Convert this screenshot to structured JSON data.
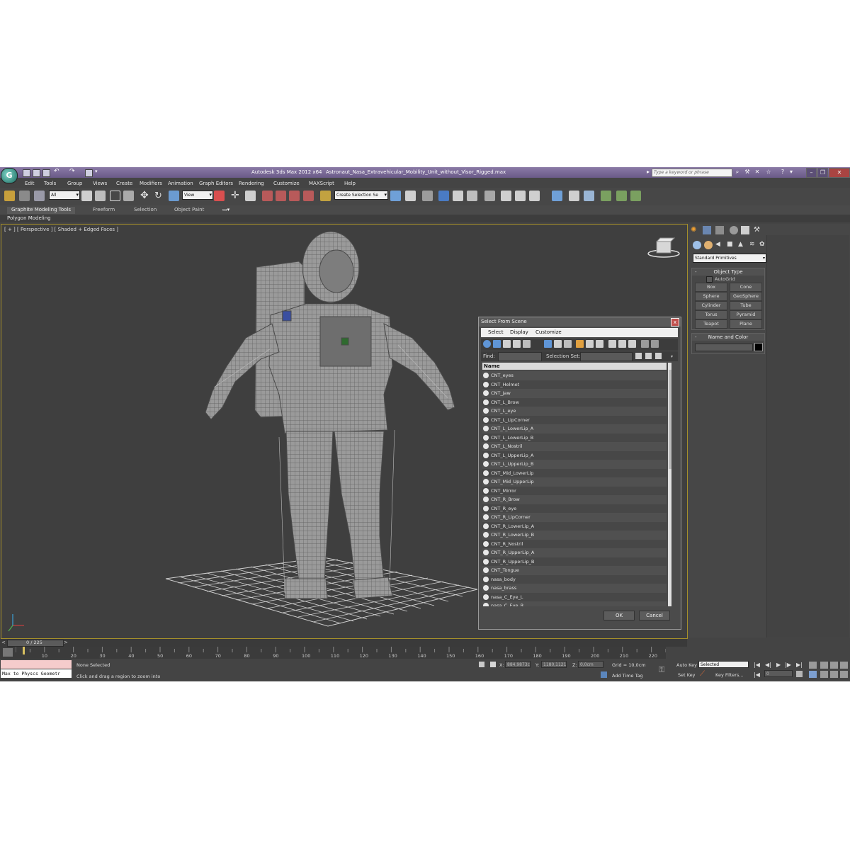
{
  "titlebar": {
    "app_name": "Autodesk 3ds Max  2012 x64",
    "file_name": "Astronaut_Nasa_Extravehicular_Mobility_Unit_without_Visor_Rigged.max",
    "search_placeholder": "Type a keyword or phrase"
  },
  "menu": [
    "Edit",
    "Tools",
    "Group",
    "Views",
    "Create",
    "Modifiers",
    "Animation",
    "Graph Editors",
    "Rendering",
    "Customize",
    "MAXScript",
    "Help"
  ],
  "toolbar": {
    "filter_value": "All",
    "refcoord_value": "View",
    "selection_set_value": "Create Selection Se"
  },
  "ribbon": {
    "tabs": [
      "Graphite Modeling Tools",
      "Freeform",
      "Selection",
      "Object Paint"
    ],
    "subpanel": "Polygon Modeling"
  },
  "viewport": {
    "label": "[ + ] [ Perspective ] [ Shaded + Edged Faces ]"
  },
  "command_panel": {
    "dropdown": "Standard Primitives",
    "object_type_title": "Object Type",
    "autogrid_label": "AutoGrid",
    "buttons": [
      "Box",
      "Cone",
      "Sphere",
      "GeoSphere",
      "Cylinder",
      "Tube",
      "Torus",
      "Pyramid",
      "Teapot",
      "Plane"
    ],
    "name_color_title": "Name and Color",
    "object_color": "#000000"
  },
  "dialog": {
    "title": "Select From Scene",
    "close_glyph": "x",
    "menus": [
      "Select",
      "Display",
      "Customize"
    ],
    "find_label": "Find:",
    "selection_set_label": "Selection Set:",
    "column_header": "Name",
    "items": [
      "CNT_eyes",
      "CNT_Helmet",
      "CNT_Jaw",
      "CNT_L_Brow",
      "CNT_L_eye",
      "CNT_L_LipCorner",
      "CNT_L_LowerLip_A",
      "CNT_L_LowerLip_B",
      "CNT_L_Nostril",
      "CNT_L_UpperLip_A",
      "CNT_L_UpperLip_B",
      "CNT_Mid_LowerLip",
      "CNT_Mid_UpperLip",
      "CNT_Mirror",
      "CNT_R_Brow",
      "CNT_R_eye",
      "CNT_R_LipCorner",
      "CNT_R_LowerLip_A",
      "CNT_R_LowerLip_B",
      "CNT_R_Nostril",
      "CNT_R_UpperLip_A",
      "CNT_R_UpperLip_B",
      "CNT_Tongue",
      "nasa_body",
      "nasa_brass",
      "nasa_C_Eye_L",
      "nasa_C_Eye_R"
    ],
    "ok_label": "OK",
    "cancel_label": "Cancel"
  },
  "timeline": {
    "position_label": "0 / 225",
    "ticks": [
      "10",
      "20",
      "30",
      "40",
      "50",
      "60",
      "70",
      "80",
      "90",
      "100",
      "110",
      "120",
      "130",
      "140",
      "150",
      "160",
      "170",
      "180",
      "190",
      "200",
      "210",
      "220"
    ]
  },
  "status": {
    "maxscript_line": "Max to Physcs Geometr",
    "selection_status": "None Selected",
    "prompt": "Click and drag a region to zoom into",
    "x_label": "X:",
    "x_value": "884,9873c",
    "y_label": "Y:",
    "y_value": "1180,1121",
    "z_label": "Z:",
    "z_value": "0,0cm",
    "grid": "Grid = 10,0cm",
    "add_time_tag": "Add Time Tag",
    "auto_key": "Auto Key",
    "set_key": "Set Key",
    "key_mode": "Selected",
    "key_filters": "Key Filters...",
    "frame": "0"
  }
}
